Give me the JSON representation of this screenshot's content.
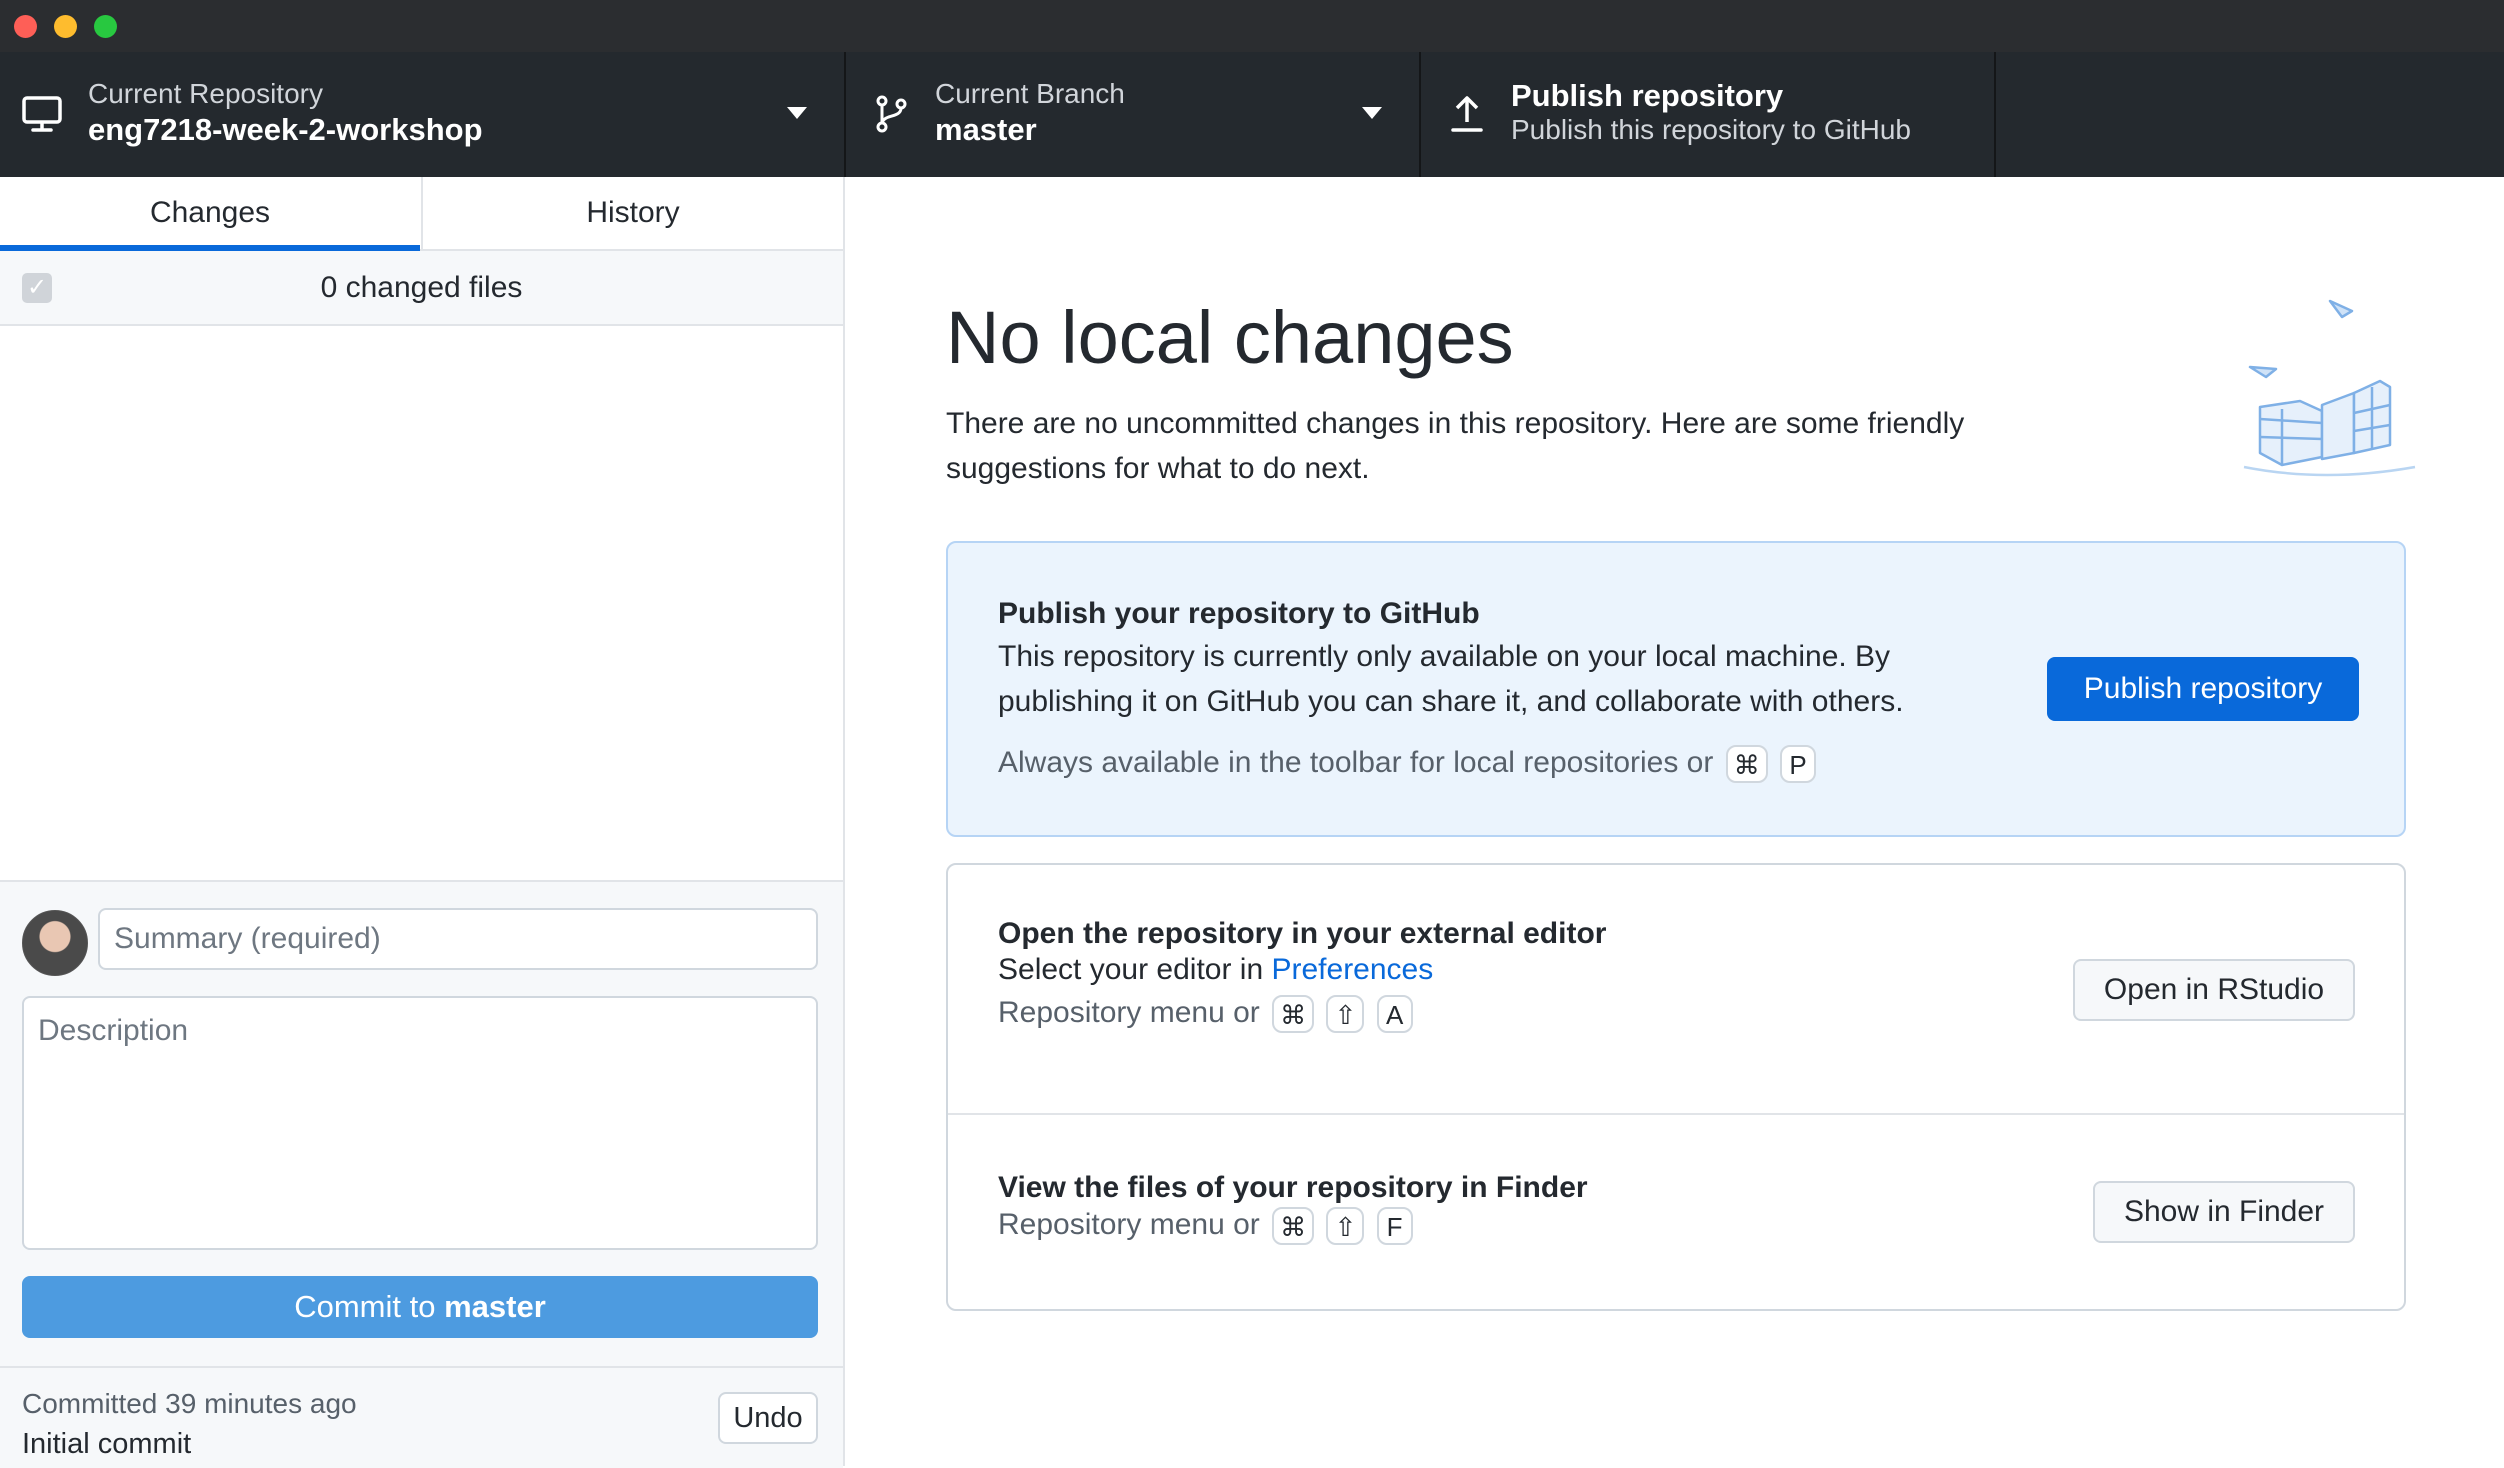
{
  "toolbar": {
    "repo_label": "Current Repository",
    "repo_name": "eng7218-week-2-workshop",
    "branch_label": "Current Branch",
    "branch_name": "master",
    "publish_title": "Publish repository",
    "publish_subtitle": "Publish this repository to GitHub"
  },
  "sidebar": {
    "tabs": [
      {
        "label": "Changes",
        "selected": true
      },
      {
        "label": "History",
        "selected": false
      }
    ],
    "changed_files": "0 changed files",
    "commit": {
      "summary_placeholder": "Summary (required)",
      "description_placeholder": "Description",
      "button_prefix": "Commit to",
      "button_branch": "master"
    },
    "last_commit": {
      "time": "Committed 39 minutes ago",
      "message": "Initial commit",
      "undo_label": "Undo"
    }
  },
  "main": {
    "heading": "No local changes",
    "subtext": "There are no uncommitted changes in this repository. Here are some friendly suggestions for what to do next.",
    "publish_card": {
      "title": "Publish your repository to GitHub",
      "description": "This repository is currently only available on your local machine. By publishing it on GitHub you can share it, and collaborate with others.",
      "hint": "Always available in the toolbar for local repositories or",
      "keys": [
        "⌘",
        "P"
      ],
      "button": "Publish repository"
    },
    "editor_card": {
      "title": "Open the repository in your external editor",
      "desc_prefix": "Select your editor in",
      "desc_link": "Preferences",
      "hint": "Repository menu or",
      "keys": [
        "⌘",
        "⇧",
        "A"
      ],
      "button": "Open in RStudio"
    },
    "finder_card": {
      "title": "View the files of your repository in Finder",
      "hint": "Repository menu or",
      "keys": [
        "⌘",
        "⇧",
        "F"
      ],
      "button": "Show in Finder"
    }
  },
  "colors": {
    "toolbar_bg": "#24292e",
    "accent_blue": "#0969da",
    "commit_button": "#4d9be0",
    "publish_card_bg": "#ebf4fd"
  }
}
